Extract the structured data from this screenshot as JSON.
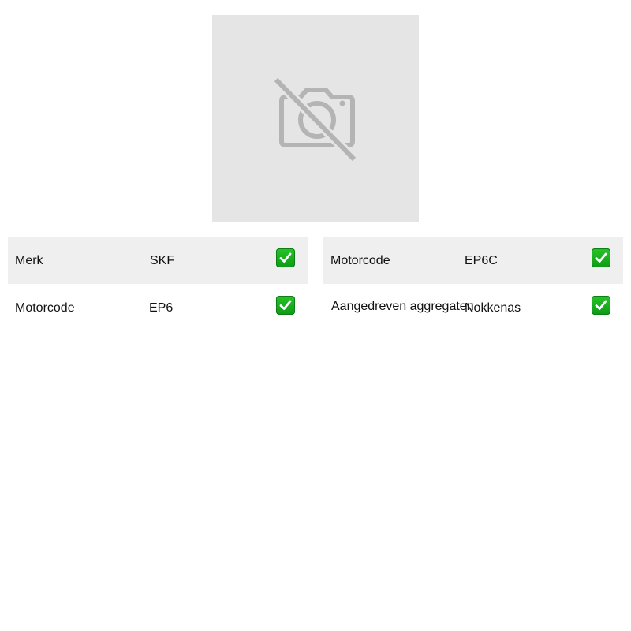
{
  "image": {
    "icon": "no-photo-icon",
    "background": "#e5e5e5",
    "icon_color": "#b4b4b4"
  },
  "specs_left": [
    {
      "label": "Merk",
      "value": "SKF",
      "icon": "check-icon"
    },
    {
      "label": "Motorcode",
      "value": "EP6",
      "icon": "check-icon"
    }
  ],
  "specs_right": [
    {
      "label": "Motorcode",
      "value": "EP6C",
      "icon": "check-icon"
    },
    {
      "label": "Aangedreven aggregaten",
      "value": "Nokkenas",
      "icon": "check-icon"
    }
  ],
  "colors": {
    "row_shade": "#efefef",
    "check": "#1fb522"
  }
}
